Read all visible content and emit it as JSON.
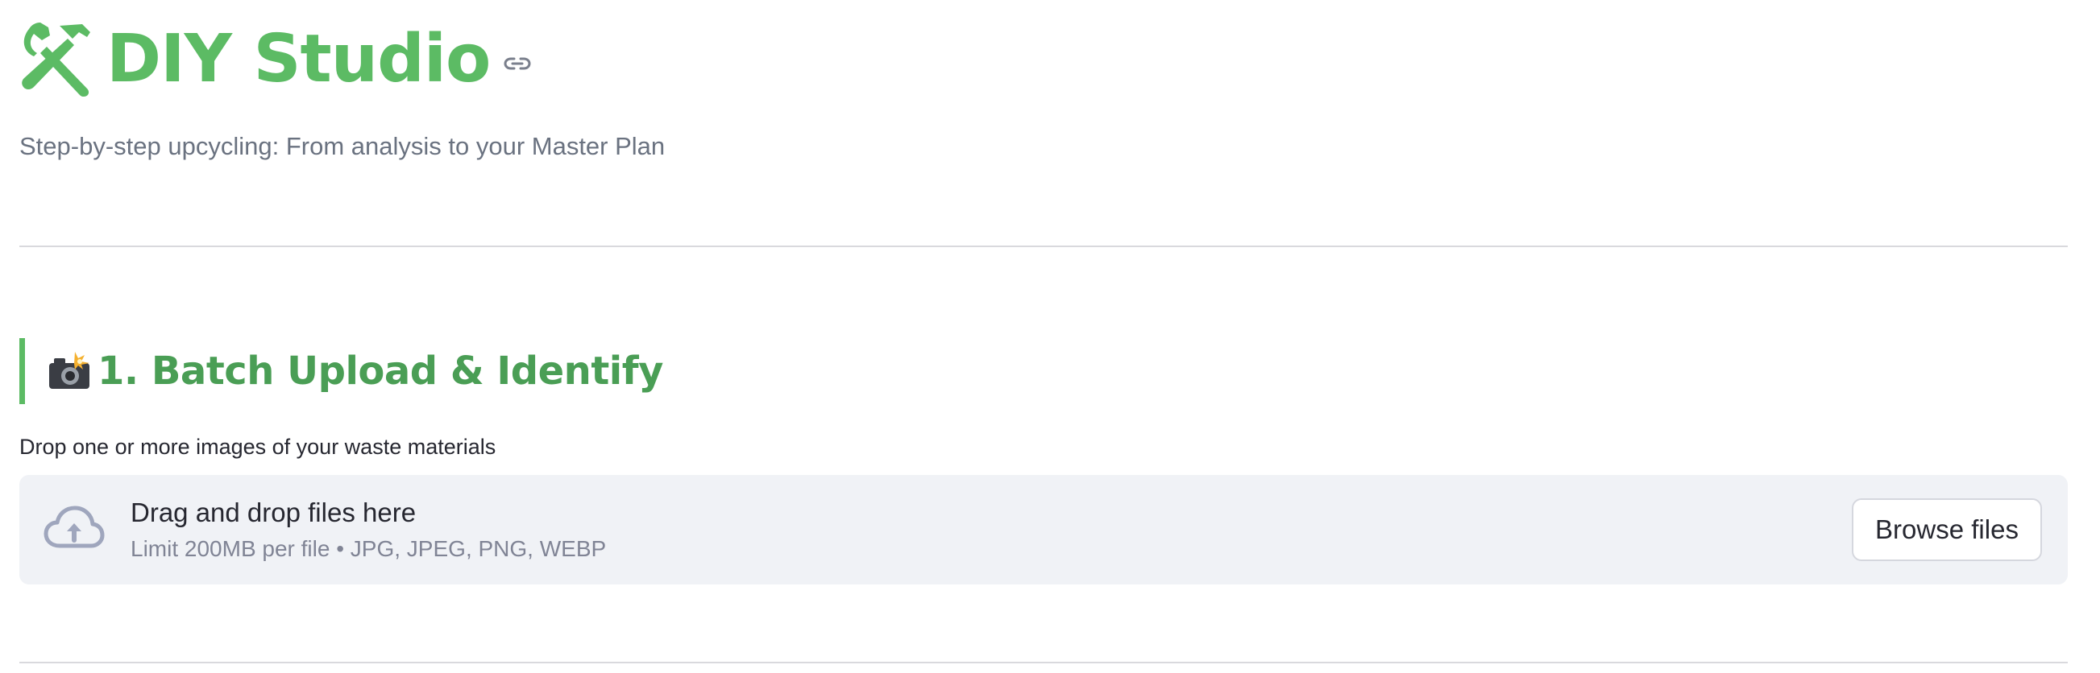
{
  "header": {
    "title": "DIY Studio",
    "title_icon": "hammer-and-wrench-icon",
    "anchor_icon": "link-icon",
    "subtitle": "Step-by-step upcycling: From analysis to your Master Plan"
  },
  "section": {
    "icon": "camera-with-flash-icon",
    "title": "1. Batch Upload & Identify",
    "upload_label": "Drop one or more images of your waste materials"
  },
  "uploader": {
    "icon": "cloud-upload-icon",
    "title": "Drag and drop files here",
    "limit": "Limit 200MB per file • JPG, JPEG, PNG, WEBP",
    "browse_label": "Browse files"
  },
  "colors": {
    "accent": "#5cbb64",
    "section_title": "#4a9e55",
    "dropzone_bg": "#f0f2f6",
    "muted_text": "#6a7280"
  }
}
